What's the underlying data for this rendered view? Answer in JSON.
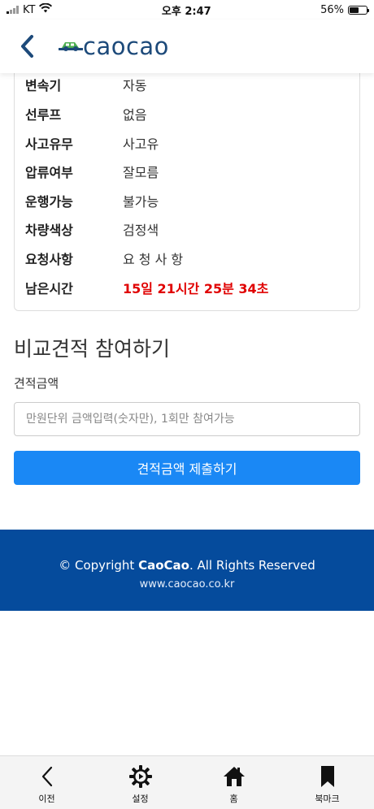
{
  "status_bar": {
    "carrier": "KT",
    "time": "오후 2:47",
    "battery": "56%",
    "battery_fraction": 0.56
  },
  "header": {
    "logo_text": "caocao"
  },
  "details": [
    {
      "label": "변속기",
      "value": "자동"
    },
    {
      "label": "선루프",
      "value": "없음"
    },
    {
      "label": "사고유무",
      "value": "사고유"
    },
    {
      "label": "압류여부",
      "value": "잘모름"
    },
    {
      "label": "운행가능",
      "value": "불가능"
    },
    {
      "label": "차량색상",
      "value": "검정색"
    },
    {
      "label": "요청사항",
      "value": "요 청 사 항"
    },
    {
      "label": "남은시간",
      "value": "15일 21시간 25분 34초"
    }
  ],
  "bid": {
    "title": "비교견적 참여하기",
    "amount_label": "견적금액",
    "amount_placeholder": "만원단위 금액입력(숫자만), 1회만 참여가능",
    "amount_value": "",
    "submit_label": "견적금액 제출하기"
  },
  "footer": {
    "copyright_prefix": "© Copyright ",
    "brand": "CaoCao",
    "copyright_suffix": ". All Rights Reserved",
    "url": "www.caocao.co.kr"
  },
  "toolbar": {
    "back_label": "이전",
    "settings_label": "설정",
    "home_label": "홈",
    "bookmark_label": "북마크"
  },
  "colors": {
    "accent": "#1a88f5",
    "footer_bg": "#054b9c",
    "countdown": "#e00000",
    "logo": "#1d4a7a"
  }
}
